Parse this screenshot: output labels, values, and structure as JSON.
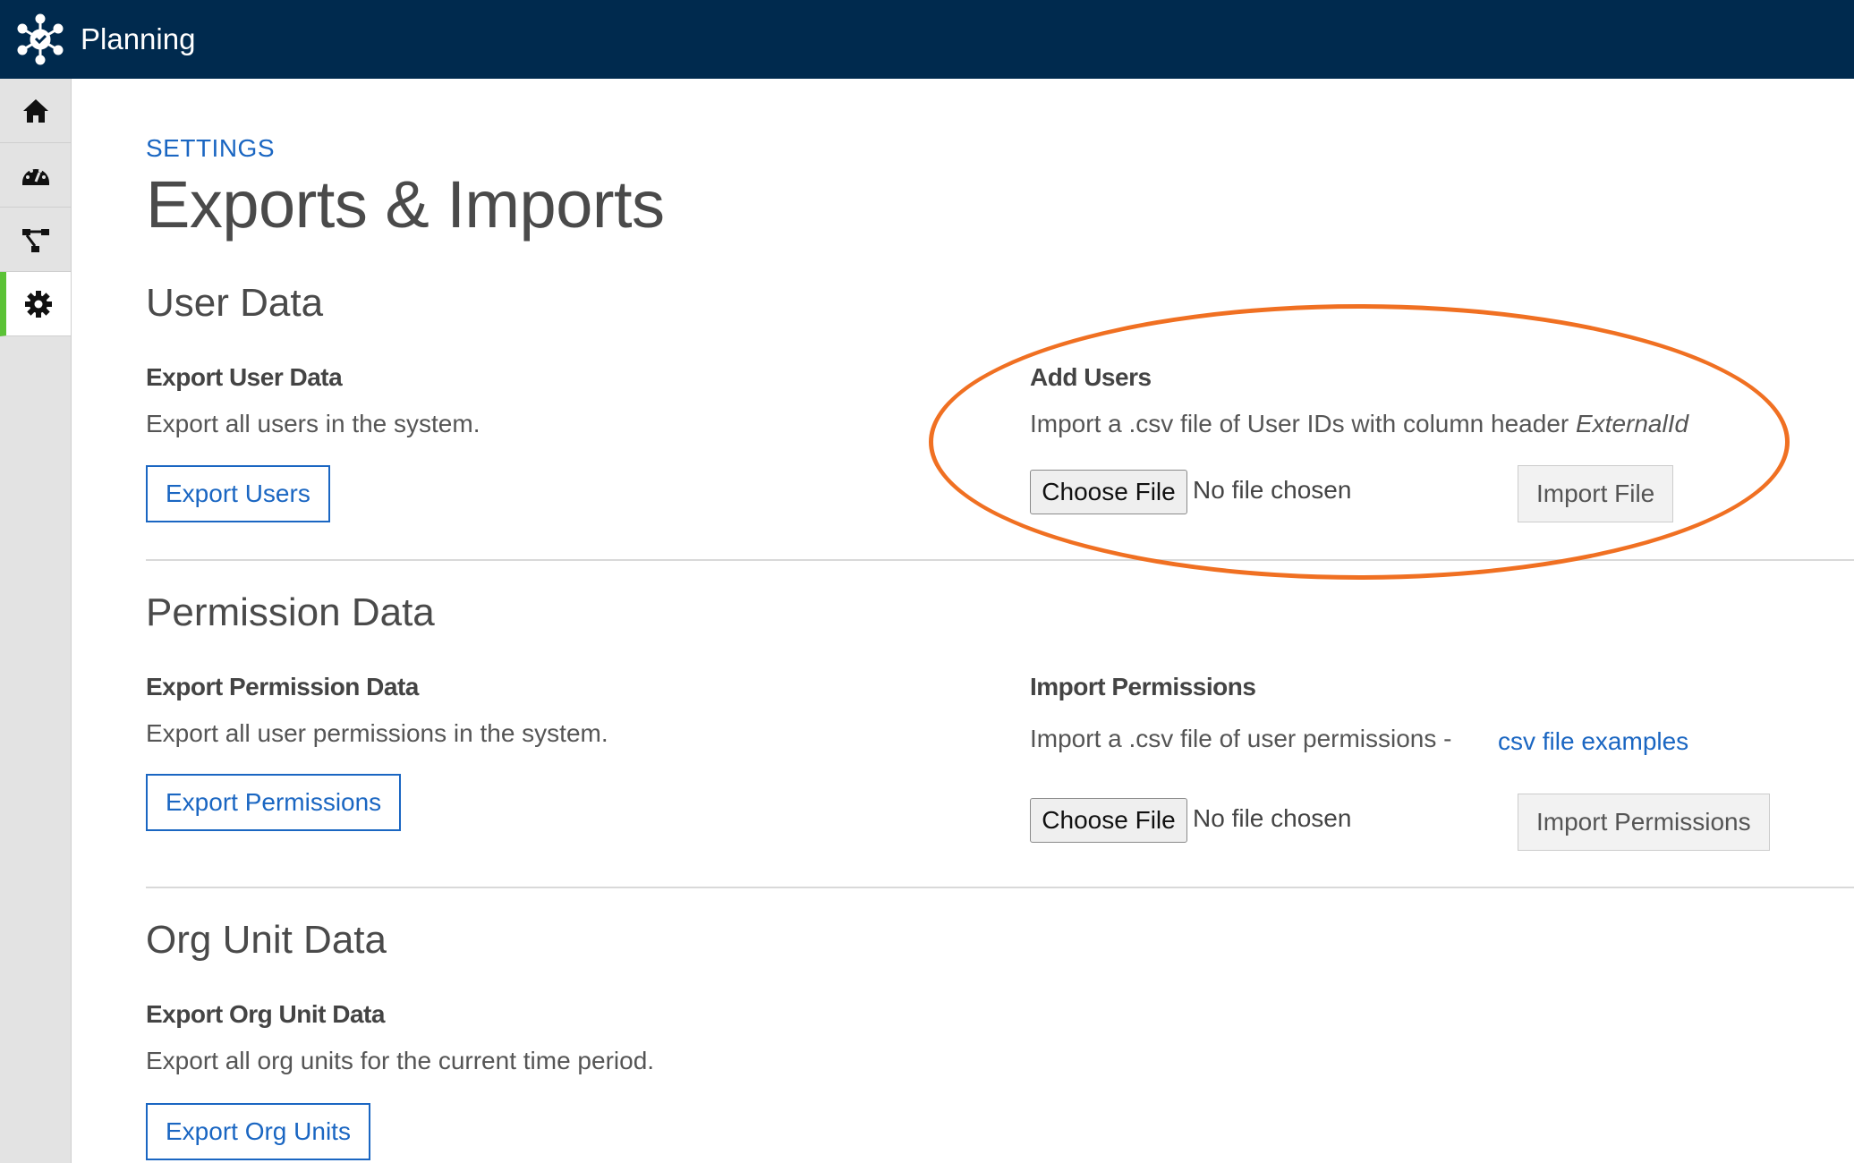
{
  "app": {
    "title": "Planning"
  },
  "sidebar": {
    "items": [
      {
        "icon": "home-icon",
        "label": "Home"
      },
      {
        "icon": "dashboard-icon",
        "label": "Dashboard"
      },
      {
        "icon": "org-chart-icon",
        "label": "Org Chart"
      },
      {
        "icon": "gear-icon",
        "label": "Settings",
        "active": true
      }
    ]
  },
  "breadcrumb": "SETTINGS",
  "page_title": "Exports & Imports",
  "sections": {
    "user": {
      "title": "User Data",
      "export_title": "Export User Data",
      "export_desc": "Export all users in the system.",
      "export_button": "Export Users",
      "import_title": "Add Users",
      "import_desc": "Import a .csv file of User IDs with column header",
      "import_desc_em": "ExternalId",
      "choose_file": "Choose File",
      "no_file": "No file chosen",
      "import_button": "Import File"
    },
    "permission": {
      "title": "Permission Data",
      "export_title": "Export Permission Data",
      "export_desc": "Export all user permissions in the system.",
      "export_button": "Export Permissions",
      "import_title": "Import Permissions",
      "import_desc": "Import a .csv file of user permissions -",
      "link": "csv file examples",
      "choose_file": "Choose File",
      "no_file": "No file chosen",
      "import_button": "Import Permissions"
    },
    "org": {
      "title": "Org Unit Data",
      "export_title": "Export Org Unit Data",
      "export_desc": "Export all org units for the current time period.",
      "export_button": "Export Org Units"
    }
  },
  "colors": {
    "topbar": "#002a4e",
    "accent": "#1a66c2",
    "active_indicator": "#5bc236",
    "highlight": "#f07022"
  }
}
